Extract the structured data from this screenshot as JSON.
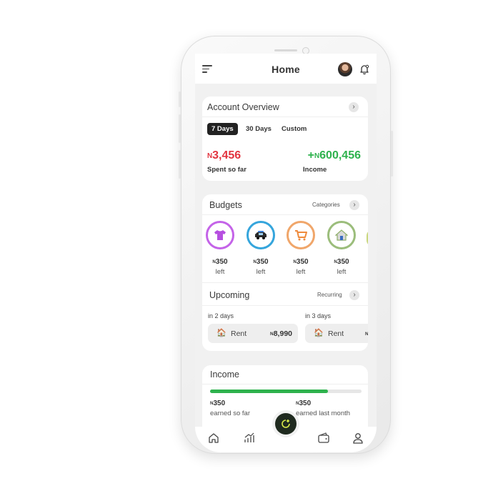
{
  "header": {
    "title": "Home",
    "menu_icon": "hamburger-menu-icon",
    "avatar": "user-avatar",
    "bell_icon": "notification-bell-icon"
  },
  "account_overview": {
    "title": "Account Overview",
    "tabs": [
      {
        "label": "7 Days",
        "active": true
      },
      {
        "label": "30 Days",
        "active": false
      },
      {
        "label": "Custom",
        "active": false
      }
    ],
    "currency": "N",
    "spent_amount": "3,456",
    "spent_label": "Spent so far",
    "income_prefix": "+",
    "income_amount": "600,456",
    "income_label": "Income",
    "colors": {
      "spent": "#e2343f",
      "income": "#2eb24d"
    }
  },
  "budgets": {
    "title": "Budgets",
    "link_label": "Categories",
    "items": [
      {
        "icon": "tshirt-icon",
        "amount": "350",
        "label": "left",
        "color": "#c463e8"
      },
      {
        "icon": "car-icon",
        "amount": "350",
        "label": "left",
        "color": "#35a5dc"
      },
      {
        "icon": "shopping-cart-icon",
        "amount": "350",
        "label": "left",
        "color": "#f0a66a"
      },
      {
        "icon": "house-icon",
        "amount": "350",
        "label": "left",
        "color": "#9bbd7b"
      }
    ]
  },
  "upcoming": {
    "title": "Upcoming",
    "link_label": "Recurring",
    "items": [
      {
        "due": "in 2 days",
        "label": "Rent",
        "amount": "8,990",
        "icon": "house-small-icon"
      },
      {
        "due": "in 3 days",
        "label": "Rent",
        "amount": "",
        "icon": "house-small-icon"
      }
    ]
  },
  "income": {
    "title": "Income",
    "progress": 0.78,
    "earned_amount": "350",
    "earned_label": "earned so far",
    "last_amount": "350",
    "last_label": "earned last month",
    "color": "#2eb24d"
  },
  "bottom_nav": {
    "items": [
      "home-icon",
      "chart-icon",
      "wallet-icon",
      "profile-icon"
    ],
    "fab_icon": "add-transaction-icon"
  }
}
